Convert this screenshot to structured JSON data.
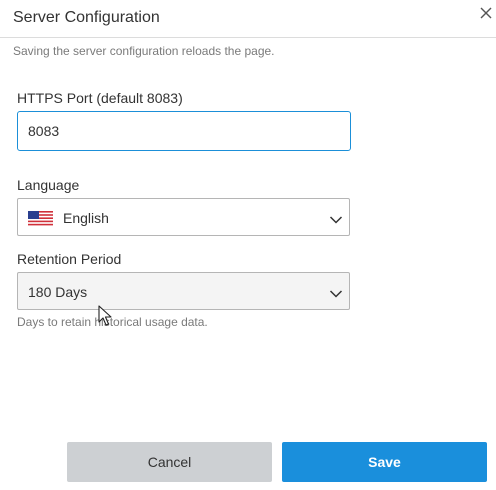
{
  "dialog": {
    "title": "Server Configuration",
    "subtitle": "Saving the server configuration reloads the page."
  },
  "fields": {
    "port": {
      "label": "HTTPS Port (default 8083)",
      "value": "8083"
    },
    "language": {
      "label": "Language",
      "value": "English",
      "flag_icon": "us-flag-icon"
    },
    "retention": {
      "label": "Retention Period",
      "value": "180 Days",
      "help": "Days to retain historical usage data."
    }
  },
  "buttons": {
    "cancel": "Cancel",
    "save": "Save"
  },
  "colors": {
    "accent": "#1a8fdc",
    "cancel_bg": "#cdd0d3"
  }
}
